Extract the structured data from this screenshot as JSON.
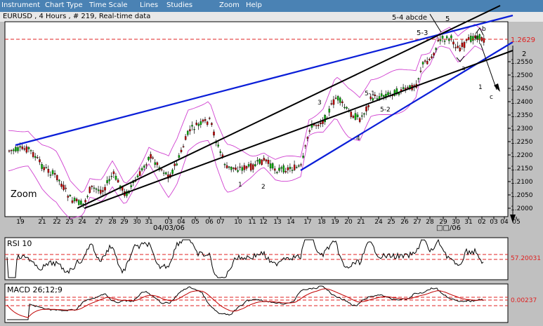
{
  "menu": {
    "items": [
      "Instrument",
      "Chart Type",
      "Time Scale",
      "Lines",
      "Studies",
      "Zoom",
      "Help"
    ]
  },
  "title": "EURUSD , 4 Hours , # 219, Real-time data",
  "zoom_label": "Zoom",
  "colors": {
    "menubar": "#4a82b4",
    "up_candle": "#00b000",
    "down_candle": "#c00000",
    "bollinger": "#d040d0",
    "trendline_blue": "#0a1ed8",
    "trendline_black": "#000000",
    "reference_line": "#e02020"
  },
  "price_axis": {
    "ticks": [
      "1.2550",
      "1.2500",
      "1.2450",
      "1.2400",
      "1.2350",
      "1.2300",
      "1.2250",
      "1.2200",
      "1.2150",
      "1.2100",
      "1.2050",
      "1.2000"
    ],
    "current_price": "1.2629"
  },
  "time_axis": {
    "days": [
      "19",
      "21",
      "22",
      "23",
      "24",
      "27",
      "28",
      "29",
      "30",
      "31",
      "03",
      "04",
      "05",
      "06",
      "07",
      "10",
      "11",
      "12",
      "13",
      "14",
      "17",
      "18",
      "19",
      "20",
      "21",
      "24",
      "25",
      "26",
      "27",
      "28",
      "29",
      "30",
      "31",
      "02",
      "03",
      "04",
      "05"
    ],
    "month_label_1": "04/03/06",
    "month_label_2": "□□/06"
  },
  "annotations": [
    "5-4 abcde",
    "5",
    "5-3",
    "b",
    "e",
    "a",
    "5-1",
    "3",
    "5-2",
    "4",
    "1",
    "2",
    "1",
    "c",
    "2"
  ],
  "rsi": {
    "label": "RSI 10",
    "value": "57.20031"
  },
  "macd": {
    "label": "MACD 26;12;9",
    "value": "0.00237"
  }
}
